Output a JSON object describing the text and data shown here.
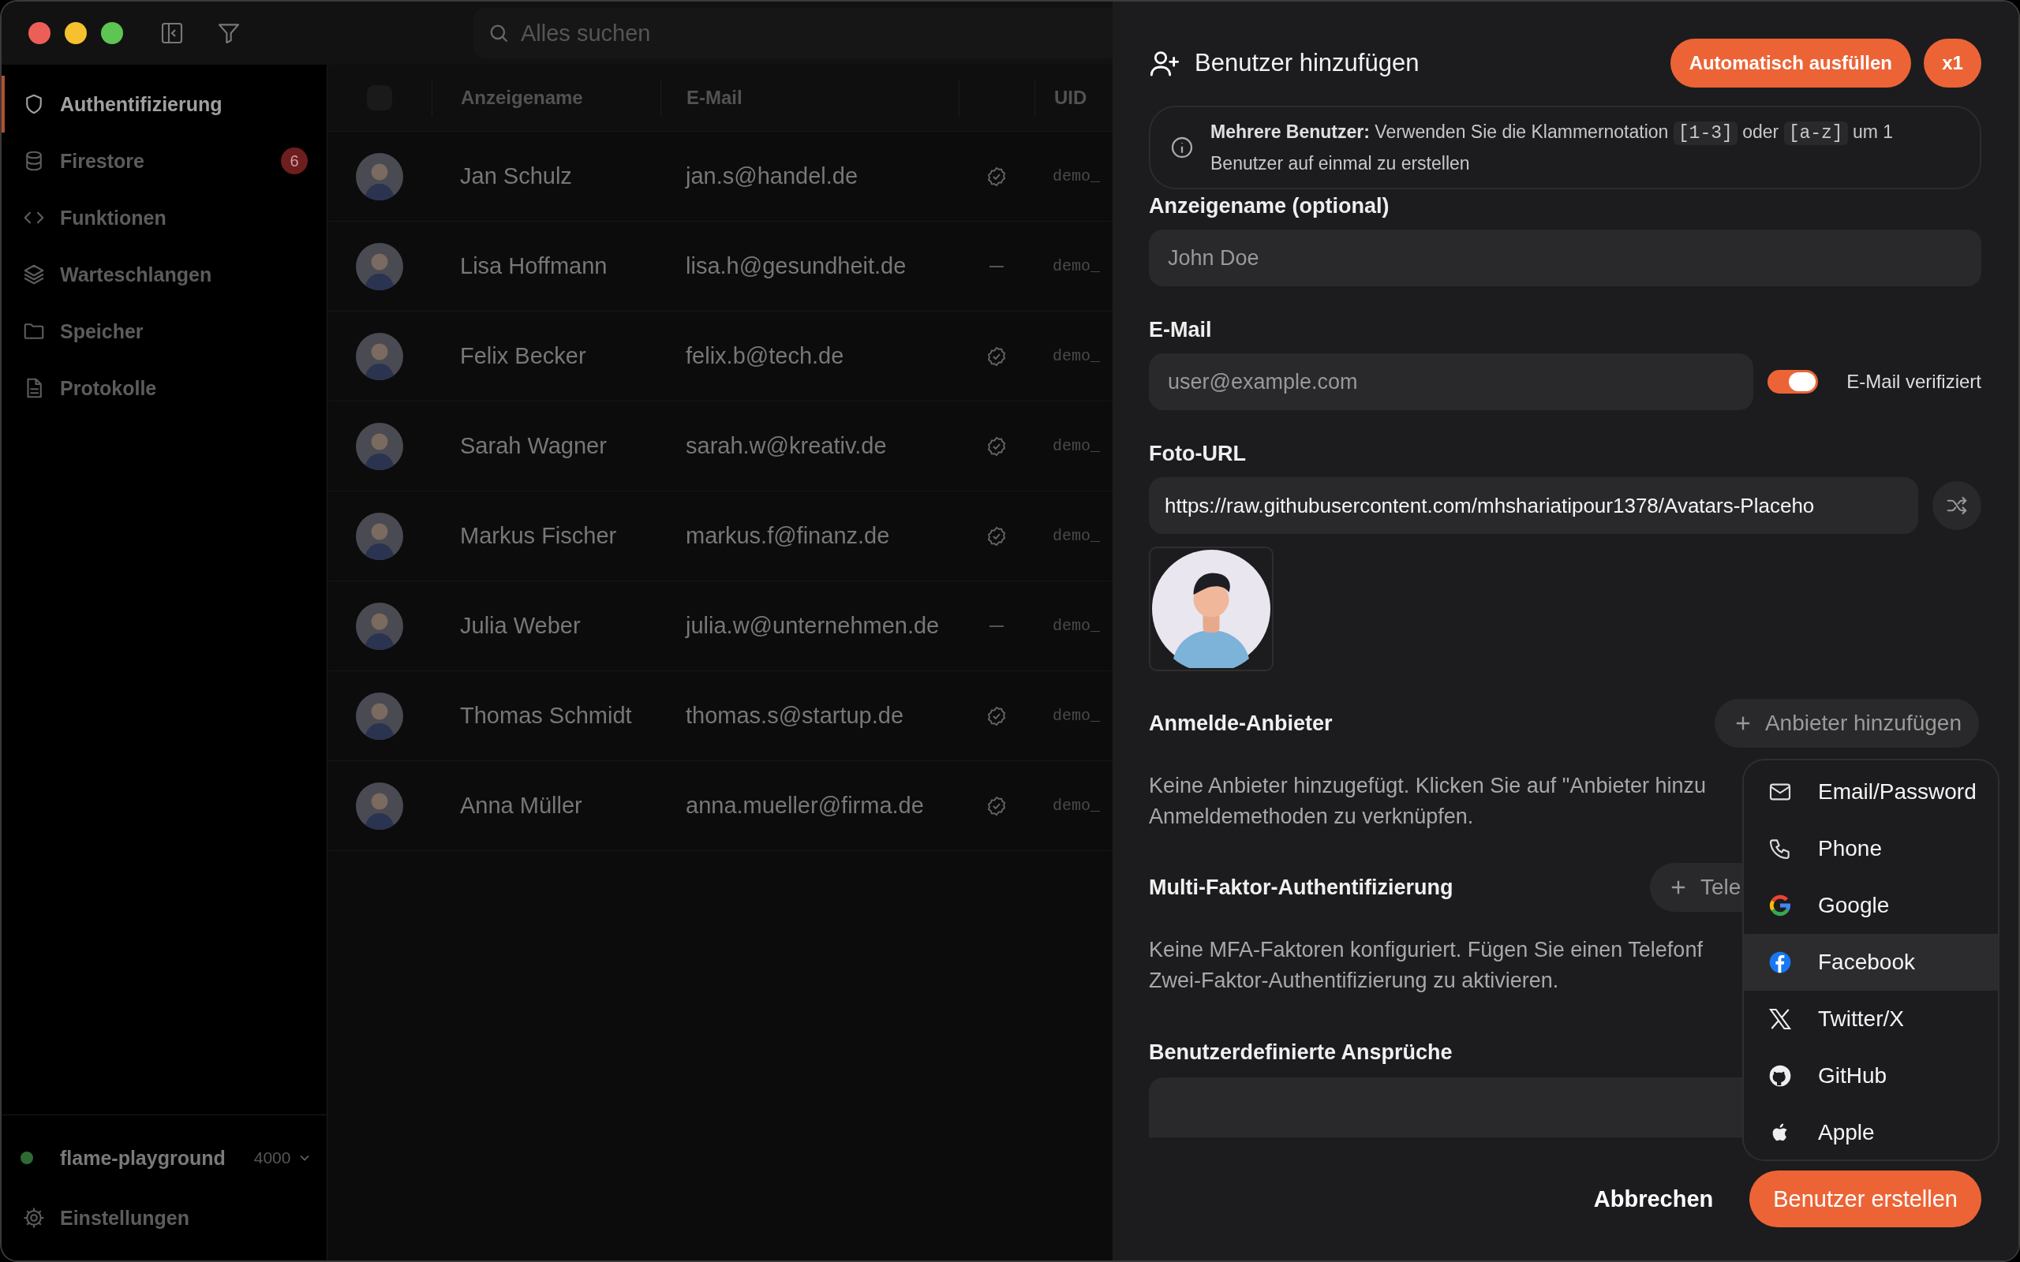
{
  "window": {
    "search": {
      "placeholder": "Alles suchen"
    }
  },
  "sidebar": {
    "items": [
      {
        "label": "Authentifizierung",
        "selected": true
      },
      {
        "label": "Firestore",
        "selected": false,
        "badge": "6"
      },
      {
        "label": "Funktionen",
        "selected": false
      },
      {
        "label": "Warteschlangen",
        "selected": false
      },
      {
        "label": "Speicher",
        "selected": false
      },
      {
        "label": "Protokolle",
        "selected": false
      }
    ],
    "project": {
      "name": "flame-playground",
      "port": "4000",
      "color": "#2f6a34"
    },
    "settings": "Einstellungen"
  },
  "table": {
    "select_all": {
      "checked": false
    },
    "columns": {
      "name": "Anzeigename",
      "email": "E-Mail",
      "uid": "UID"
    },
    "rows": [
      {
        "name": "Jan Schulz",
        "email": "jan.s@handel.de",
        "verified": true,
        "uid": "demo_"
      },
      {
        "name": "Lisa Hoffmann",
        "email": "lisa.h@gesundheit.de",
        "verified": false,
        "uid": "demo_"
      },
      {
        "name": "Felix Becker",
        "email": "felix.b@tech.de",
        "verified": true,
        "uid": "demo_"
      },
      {
        "name": "Sarah Wagner",
        "email": "sarah.w@kreativ.de",
        "verified": true,
        "uid": "demo_"
      },
      {
        "name": "Markus Fischer",
        "email": "markus.f@finanz.de",
        "verified": true,
        "uid": "demo_"
      },
      {
        "name": "Julia Weber",
        "email": "julia.w@unternehmen.de",
        "verified": false,
        "uid": "demo_"
      },
      {
        "name": "Thomas Schmidt",
        "email": "thomas.s@startup.de",
        "verified": true,
        "uid": "demo_"
      },
      {
        "name": "Anna Müller",
        "email": "anna.mueller@firma.de",
        "verified": true,
        "uid": "demo_"
      }
    ]
  },
  "panel": {
    "title": "Benutzer hinzufügen",
    "autofill": "Automatisch ausfüllen",
    "count": "x1",
    "info": [
      {
        "kind": "text",
        "text": "**Mehrere Benutzer:** Verwenden Sie die Klammernotation "
      },
      {
        "kind": "code",
        "text": "[1-3]"
      },
      {
        "kind": "text",
        "text": " oder "
      },
      {
        "kind": "code",
        "text": "[a-z]"
      },
      {
        "kind": "text",
        "text": " um 1 Benutzer auf einmal zu erstellen"
      }
    ],
    "display_name": {
      "label": "Anzeigename (optional)",
      "placeholder": "John Doe"
    },
    "email": {
      "label": "E-Mail",
      "placeholder": "user@example.com",
      "verified_label": "E-Mail verifiziert",
      "verified_on": true
    },
    "photo": {
      "label": "Foto-URL",
      "value": "https://raw.githubusercontent.com/mhshariatipour1378/Avatars-Placeho"
    },
    "providers": {
      "title": "Anmelde-Anbieter",
      "add_button": "Anbieter hinzufügen",
      "empty_lines": [
        "Keine Anbieter hinzugefügt. Klicken Sie auf \"Anbieter hinzu",
        "Anmeldemethoden zu verknüpfen."
      ]
    },
    "mfa": {
      "title": "Multi-Faktor-Authentifizierung",
      "add_button": "Tele",
      "empty_lines": [
        "Keine MFA-Faktoren konfiguriert. Fügen Sie einen Telefonf",
        "Zwei-Faktor-Authentifizierung zu aktivieren."
      ]
    },
    "claims": {
      "title": "Benutzerdefinierte Ansprüche"
    },
    "provider_menu": [
      {
        "label": "Email/Password",
        "selected": false
      },
      {
        "label": "Phone",
        "selected": false
      },
      {
        "label": "Google",
        "selected": false
      },
      {
        "label": "Facebook",
        "selected": true
      },
      {
        "label": "Twitter/X",
        "selected": false
      },
      {
        "label": "GitHub",
        "selected": false
      },
      {
        "label": "Apple",
        "selected": false
      }
    ],
    "footer": {
      "cancel": "Abbrechen",
      "submit": "Benutzer erstellen"
    }
  }
}
